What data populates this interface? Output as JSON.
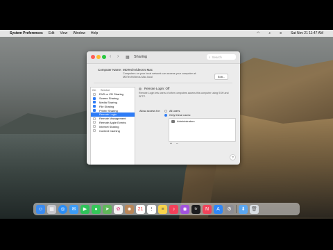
{
  "menubar": {
    "apple": "",
    "app_name": "System Preferences",
    "items": [
      "Edit",
      "View",
      "Window",
      "Help"
    ],
    "clock": "Sat Nov 21  11:47 AM"
  },
  "window": {
    "title": "Sharing",
    "search_placeholder": "Search",
    "computer_name_label": "Computer Name:",
    "computer_name_value": "MDTechVideos's Mac",
    "computer_name_note": "Computers on your local network can access your computer at: MDTechVideos-Mac.local",
    "edit_label": "Edit...",
    "services_header_on": "On",
    "services_header_service": "Service",
    "services": [
      {
        "label": "DVD or CD Sharing",
        "checked": false
      },
      {
        "label": "Screen Sharing",
        "checked": true
      },
      {
        "label": "Media Sharing",
        "checked": true
      },
      {
        "label": "File Sharing",
        "checked": true
      },
      {
        "label": "Printer Sharing",
        "checked": true
      },
      {
        "label": "Remote Login",
        "checked": true
      },
      {
        "label": "Remote Management",
        "checked": false
      },
      {
        "label": "Remote Apple Events",
        "checked": false
      },
      {
        "label": "Internet Sharing",
        "checked": false
      },
      {
        "label": "Content Caching",
        "checked": false
      }
    ],
    "selected_service_index": 5,
    "status_label": "Remote Login: Off",
    "status_note": "Remote Login lets users of other computers access this computer using SSH and SFTP.",
    "allow_access_label": "Allow access for:",
    "option_all_users": "All users",
    "option_only_these": "Only these users:",
    "users": [
      "Administrators"
    ],
    "plus": "+",
    "minus": "−",
    "help": "?"
  },
  "dock": {
    "apps": [
      "finder-icon",
      "launchpad-icon",
      "safari-icon",
      "mail-icon",
      "facetime-icon",
      "messages-icon",
      "maps-icon",
      "photos-icon",
      "contacts-icon",
      "calendar-icon",
      "reminders-icon",
      "notes-icon",
      "music-icon",
      "podcasts-icon",
      "tv-icon",
      "news-icon",
      "app-store-icon",
      "system-preferences-icon",
      "downloads-icon",
      "trash-icon"
    ],
    "calendar_day": "21",
    "tv_label": "tv"
  }
}
